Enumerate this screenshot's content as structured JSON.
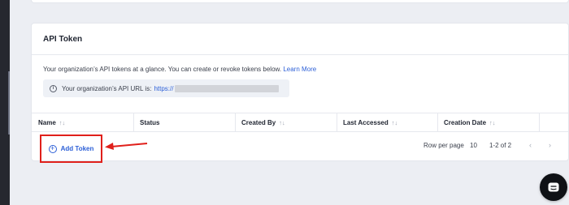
{
  "card": {
    "title": "API Token",
    "description": "Your organization’s API tokens at a glance. You can create or revoke tokens below.",
    "learn_more": "Learn More",
    "api_url_label": "Your organization’s API URL is:",
    "api_url_prefix": "https://"
  },
  "table": {
    "columns": [
      {
        "label": "Name",
        "sortable": true
      },
      {
        "label": "Status",
        "sortable": false
      },
      {
        "label": "Created By",
        "sortable": true
      },
      {
        "label": "Last Accessed",
        "sortable": true
      },
      {
        "label": "Creation Date",
        "sortable": true
      }
    ],
    "sort_glyph": "↑↓"
  },
  "actions": {
    "add_token_label": "Add Token"
  },
  "pagination": {
    "rows_per_page_label": "Row per page",
    "rows_per_page_value": "10",
    "range": "1-2 of 2",
    "prev_glyph": "‹",
    "next_glyph": "›"
  },
  "icons": {
    "info": "info-icon",
    "add": "plus-circle-icon",
    "chat": "chat-icon"
  },
  "colors": {
    "accent": "#2c5fd7",
    "highlight": "#e0201b",
    "background": "#eceef3"
  }
}
